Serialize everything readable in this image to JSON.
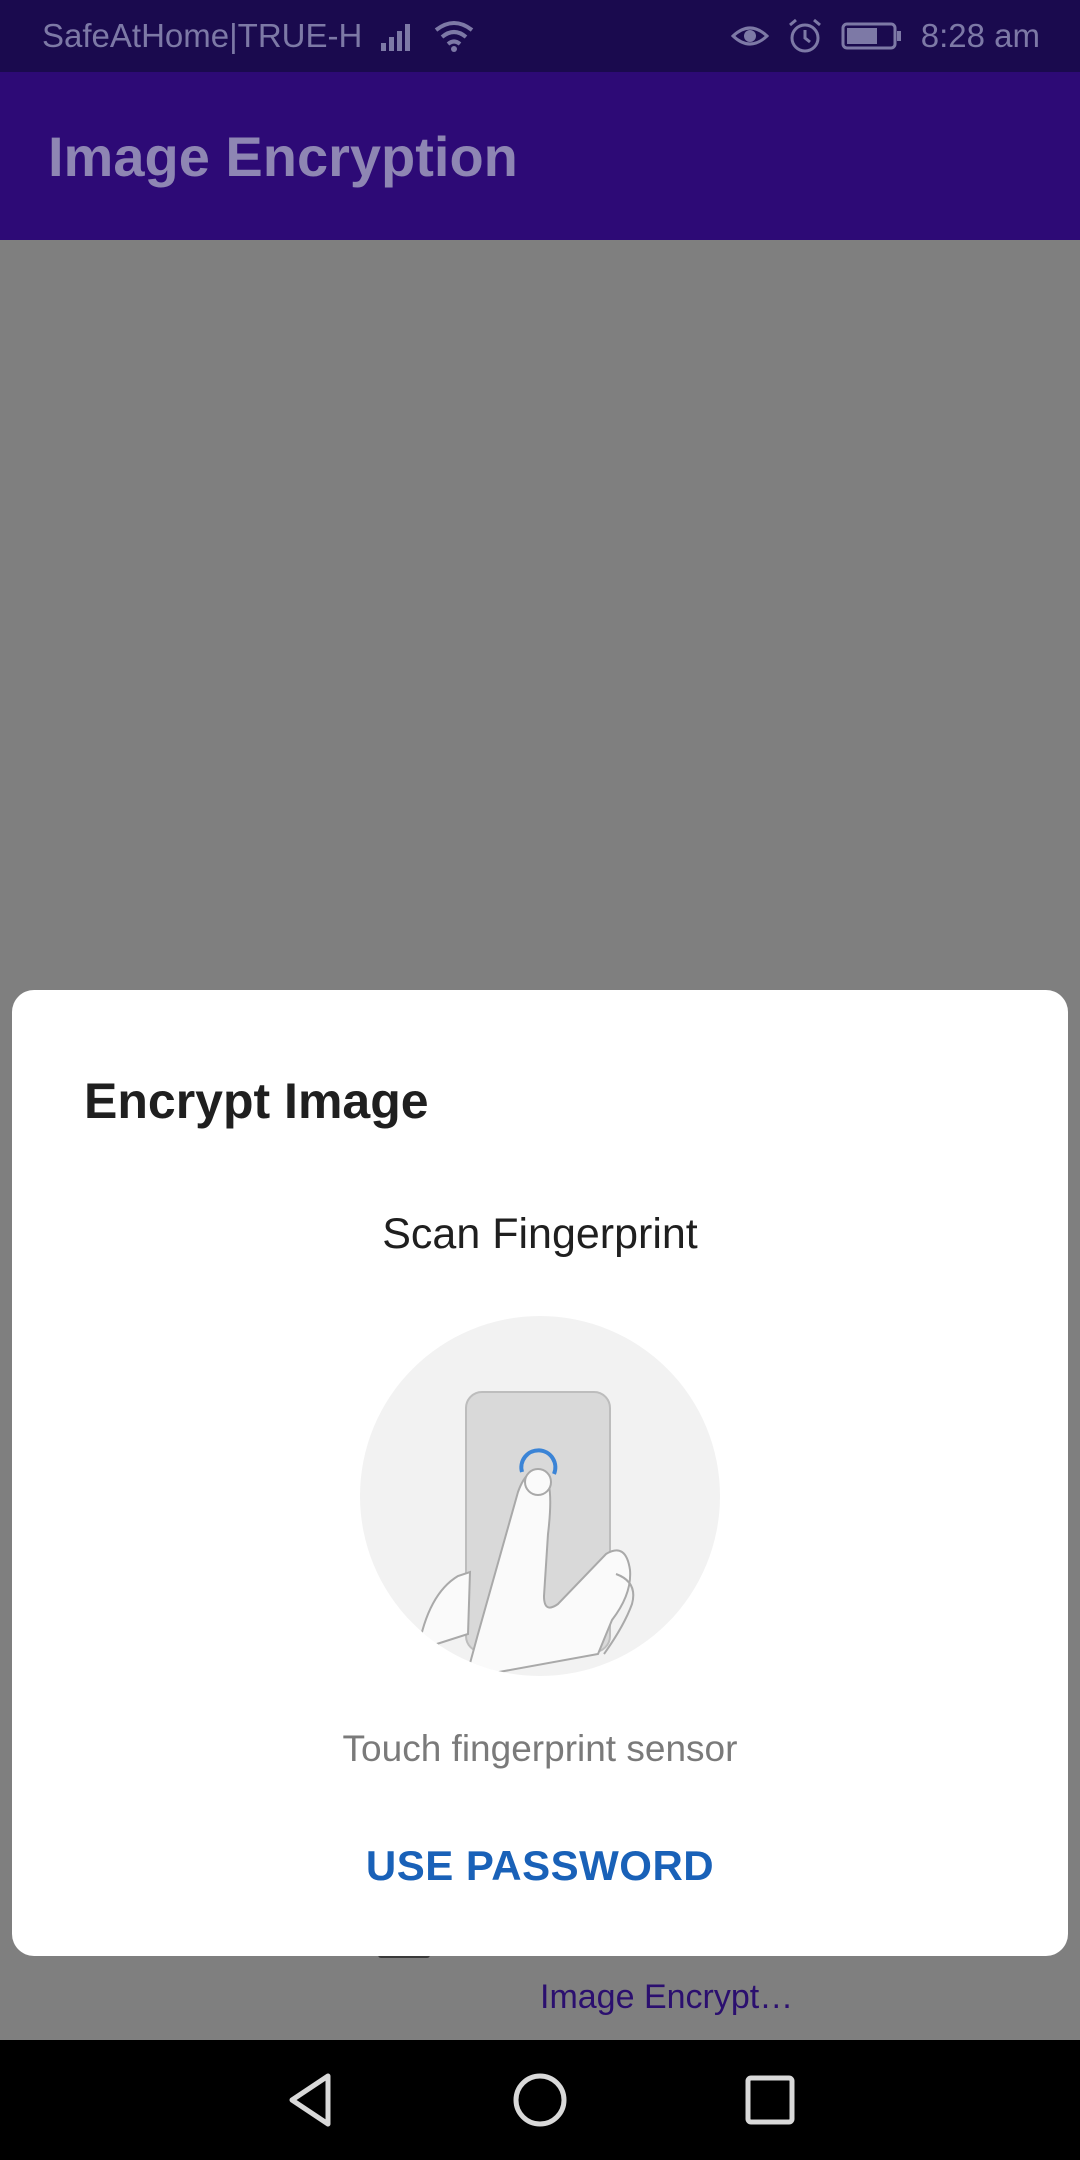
{
  "status_bar": {
    "carrier": "SafeAtHome|TRUE-H",
    "time": "8:28 am",
    "icons": [
      "signal-icon",
      "wifi-icon",
      "eye-icon",
      "alarm-icon",
      "battery-icon"
    ]
  },
  "app_bar": {
    "title": "Image Encryption"
  },
  "bottom_nav": {
    "items": [
      {
        "icon": "home-icon",
        "label": ""
      },
      {
        "icon": "check-box-icon",
        "label": ""
      },
      {
        "icon": "image-encrypt-icon",
        "label": "Image Encrypt…"
      },
      {
        "icon": "bell-icon",
        "label": ""
      }
    ]
  },
  "dialog": {
    "title": "Encrypt Image",
    "subtitle": "Scan Fingerprint",
    "hint": "Touch fingerprint sensor",
    "action_label": "USE PASSWORD"
  },
  "colors": {
    "status_bar": "#1a0a4e",
    "app_bar": "#2d0a76",
    "scrim": "#7f7f7f",
    "action": "#1961b8"
  },
  "system_nav": [
    "back-icon",
    "home-circle-icon",
    "recents-icon"
  ]
}
